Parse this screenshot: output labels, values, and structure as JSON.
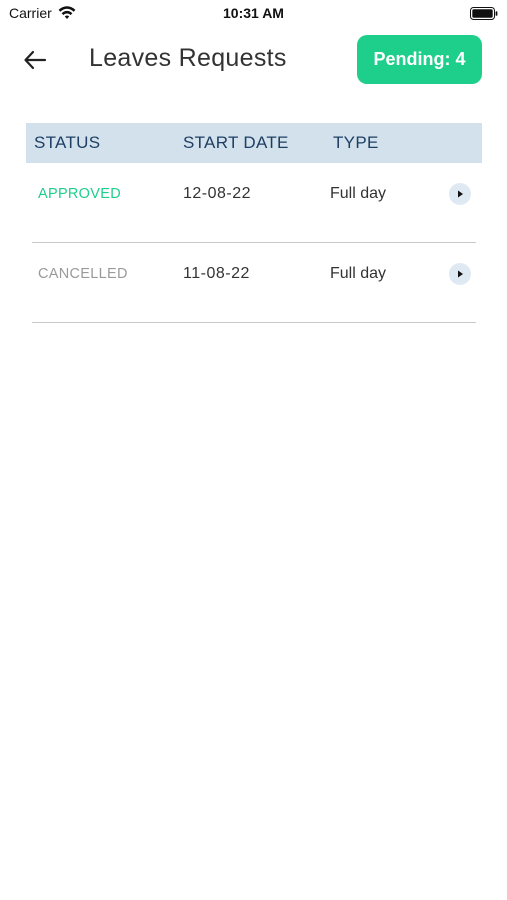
{
  "status_bar": {
    "carrier": "Carrier",
    "time": "10:31 AM"
  },
  "header": {
    "title": "Leaves Requests",
    "pending_badge": "Pending: 4"
  },
  "table": {
    "columns": [
      "STATUS",
      "START DATE",
      "TYPE"
    ],
    "rows": [
      {
        "status": "APPROVED",
        "start_date": "12-08-22",
        "type": "Full day"
      },
      {
        "status": "CANCELLED",
        "start_date": "11-08-22",
        "type": "Full day"
      }
    ]
  },
  "colors": {
    "approved": "#1ecf8c",
    "cancelled": "#9a9a9a",
    "header_bg": "#d3e1ec",
    "header_text": "#1d3f63",
    "badge_bg": "#1ecf8c"
  },
  "icons": {
    "back": "arrow-left-icon",
    "row_action": "play-triangle-icon",
    "wifi": "wifi-icon",
    "battery": "battery-icon"
  }
}
